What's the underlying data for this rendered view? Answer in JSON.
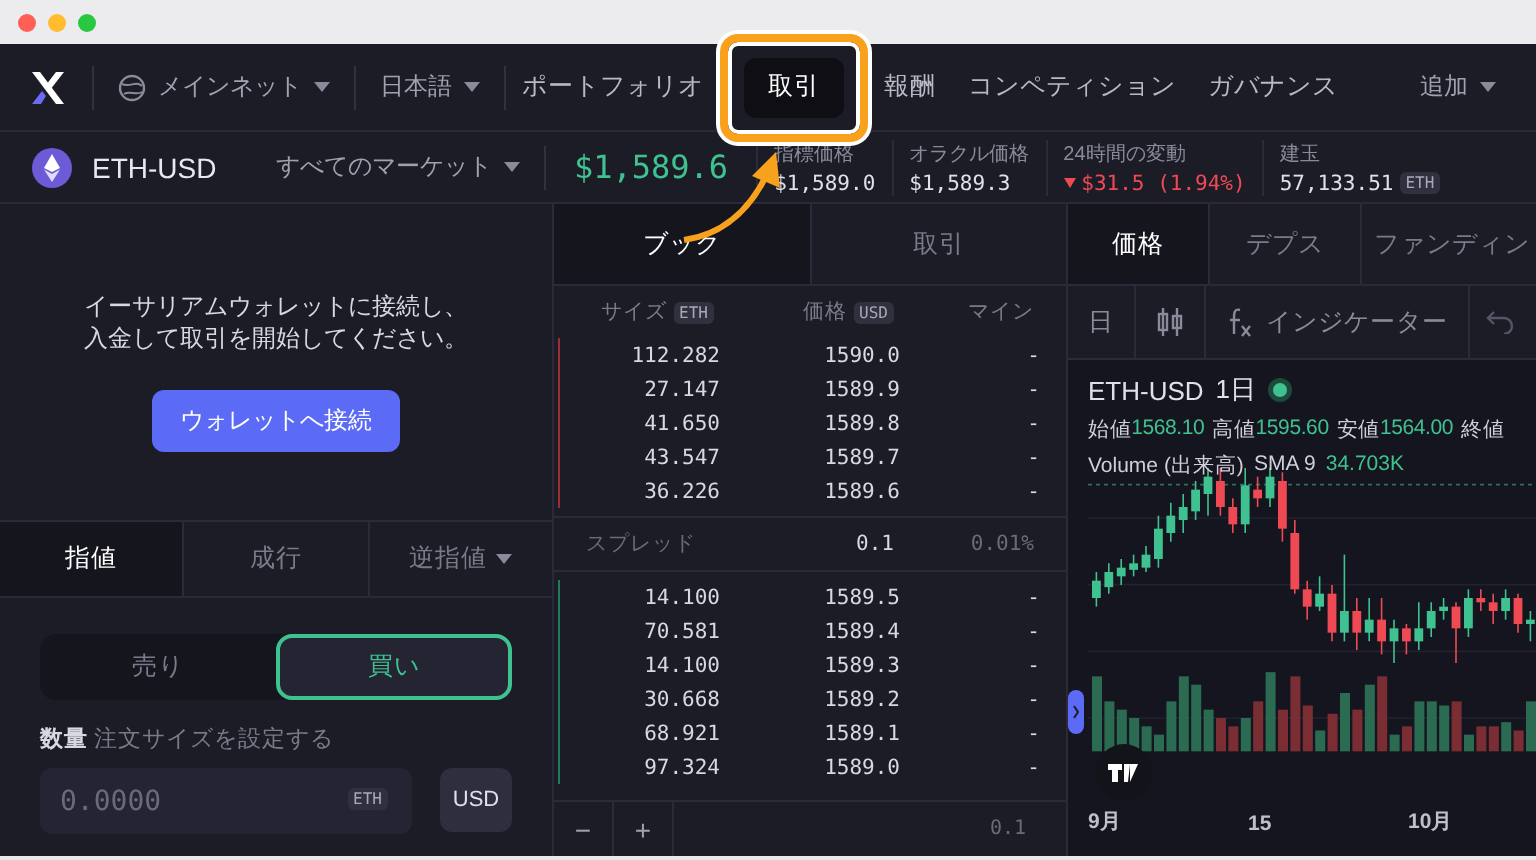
{
  "browser": {
    "dots": [
      {
        "color": "#ff5f57"
      },
      {
        "color": "#febc2e"
      },
      {
        "color": "#28c840"
      }
    ]
  },
  "nav": {
    "network": "メインネット",
    "language": "日本語",
    "items": [
      {
        "label": "ポートフォリオ",
        "selected": false,
        "highlighted": false
      },
      {
        "label": "取引",
        "selected": true,
        "highlighted": true
      },
      {
        "label": "報酬",
        "selected": false,
        "highlighted": false
      },
      {
        "label": "コンペティション",
        "selected": false,
        "highlighted": false
      },
      {
        "label": "ガバナンス",
        "selected": false,
        "highlighted": false
      }
    ],
    "more": "追加"
  },
  "market": {
    "symbol": "ETH-USD",
    "selector": "すべてのマーケット",
    "price": "$1,589.6",
    "stats": [
      {
        "label": "指標価格",
        "value": "$1,589.0",
        "down": false
      },
      {
        "label": "オラクル価格",
        "value": "$1,589.3",
        "down": false
      },
      {
        "label": "24時間の変動",
        "value": "$31.5 (1.94%)",
        "down": true
      },
      {
        "label": "建玉",
        "value": "57,133.51",
        "unit": "ETH",
        "down": false
      }
    ]
  },
  "wallet": {
    "message": "イーサリアムウォレットに接続し、入金して取引を開始してください。",
    "button": "ウォレットへ接続"
  },
  "order_tabs": [
    {
      "label": "指値",
      "selected": true,
      "dropdown": false
    },
    {
      "label": "成行",
      "selected": false,
      "dropdown": false
    },
    {
      "label": "逆指値",
      "selected": false,
      "dropdown": true
    }
  ],
  "side": [
    {
      "label": "売り",
      "selected": false
    },
    {
      "label": "買い",
      "selected": true
    }
  ],
  "amount": {
    "label": "数量",
    "hint": "注文サイズを設定する",
    "placeholder": "0.0000",
    "unit": "ETH",
    "toggle": "USD"
  },
  "orderbook": {
    "tabs": [
      {
        "label": "ブック",
        "selected": true
      },
      {
        "label": "取引",
        "selected": false
      }
    ],
    "columns": [
      {
        "label": "サイズ",
        "unit": "ETH"
      },
      {
        "label": "価格",
        "unit": "USD"
      },
      {
        "label": "マイン"
      }
    ],
    "asks": [
      {
        "size": "112.282",
        "price": "1590.0",
        "mine": "-"
      },
      {
        "size": "27.147",
        "price": "1589.9",
        "mine": "-"
      },
      {
        "size": "41.650",
        "price": "1589.8",
        "mine": "-"
      },
      {
        "size": "43.547",
        "price": "1589.7",
        "mine": "-"
      },
      {
        "size": "36.226",
        "price": "1589.6",
        "mine": "-"
      }
    ],
    "spread": {
      "label": "スプレッド",
      "value": "0.1",
      "percent": "0.01%"
    },
    "bids": [
      {
        "size": "14.100",
        "price": "1589.5",
        "mine": "-"
      },
      {
        "size": "70.581",
        "price": "1589.4",
        "mine": "-"
      },
      {
        "size": "14.100",
        "price": "1589.3",
        "mine": "-"
      },
      {
        "size": "30.668",
        "price": "1589.2",
        "mine": "-"
      },
      {
        "size": "68.921",
        "price": "1589.1",
        "mine": "-"
      },
      {
        "size": "97.324",
        "price": "1589.0",
        "mine": "-"
      }
    ],
    "minus": "−",
    "plus": "+",
    "step": "0.1"
  },
  "chart": {
    "tabs": [
      {
        "label": "価格",
        "selected": true
      },
      {
        "label": "デプス",
        "selected": false
      },
      {
        "label": "ファンディン",
        "selected": false
      }
    ],
    "interval": "日",
    "indicators": "インジケーター",
    "title": "ETH-USD",
    "period": "1日",
    "ohlc": [
      {
        "label": "始値",
        "value": "1568.10"
      },
      {
        "label": "高値",
        "value": "1595.60"
      },
      {
        "label": "安値",
        "value": "1564.00"
      },
      {
        "label": "終値"
      }
    ],
    "volume": {
      "label": "Volume (出来高)",
      "sma": "SMA 9",
      "value": "34.703K"
    },
    "x_labels": [
      "9月",
      "15",
      "10月"
    ]
  }
}
